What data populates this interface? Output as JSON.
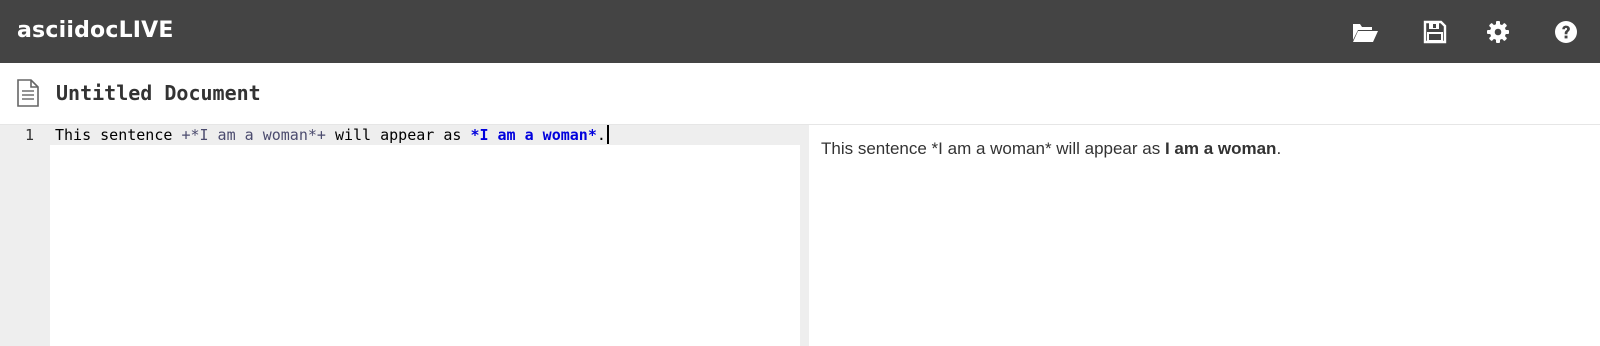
{
  "app": {
    "brand": "asciidocLIVE"
  },
  "toolbar": {
    "open_icon": "folder-open-icon",
    "save_icon": "floppy-disk-icon",
    "settings_icon": "gear-icon",
    "help_icon": "question-circle-icon"
  },
  "document": {
    "icon": "file-text-icon",
    "title": "Untitled Document"
  },
  "editor": {
    "lines": [
      {
        "number": "1",
        "tokens": {
          "t1": "This sentence ",
          "t2": "+*I am a woman*+",
          "t3": " will appear as ",
          "t4": "*I am a woman*",
          "t5": "."
        }
      }
    ]
  },
  "preview": {
    "paragraph": {
      "text_before": "This sentence *I am a woman* will appear as ",
      "bold": "I am a woman",
      "text_after": "."
    }
  },
  "colors": {
    "topbar": "#444444",
    "passthrough": "#4b4b6e",
    "strong_markup": "#0000dd",
    "gutter": "#eeeeee"
  }
}
